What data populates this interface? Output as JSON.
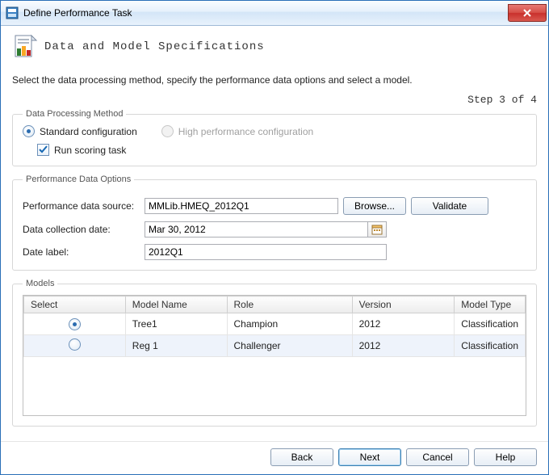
{
  "titlebar": {
    "title": "Define Performance Task"
  },
  "header": {
    "title": "Data and Model Specifications"
  },
  "subtitle": "Select the data processing method, specify the performance data options and select a model.",
  "step": "Step 3 of 4",
  "dataProcessing": {
    "legend": "Data Processing Method",
    "standard": {
      "label": "Standard configuration",
      "checked": true
    },
    "highPerf": {
      "label": "High performance configuration",
      "checked": false,
      "disabled": true
    },
    "runScoring": {
      "label": "Run scoring task",
      "checked": true
    }
  },
  "perfOptions": {
    "legend": "Performance Data Options",
    "sourceLabel": "Performance data source:",
    "sourceValue": "MMLib.HMEQ_2012Q1",
    "browse": "Browse...",
    "validate": "Validate",
    "dateLabel": "Data collection date:",
    "dateValue": "Mar 30, 2012",
    "labelLabel": "Date label:",
    "labelValue": "2012Q1"
  },
  "models": {
    "legend": "Models",
    "columns": {
      "select": "Select",
      "name": "Model Name",
      "role": "Role",
      "version": "Version",
      "type": "Model Type"
    },
    "rows": [
      {
        "selected": true,
        "name": "Tree1",
        "role": "Champion",
        "version": "2012",
        "type": "Classification"
      },
      {
        "selected": false,
        "name": "Reg 1",
        "role": "Challenger",
        "version": "2012",
        "type": "Classification"
      }
    ]
  },
  "buttons": {
    "back": "Back",
    "next": "Next",
    "cancel": "Cancel",
    "help": "Help"
  }
}
